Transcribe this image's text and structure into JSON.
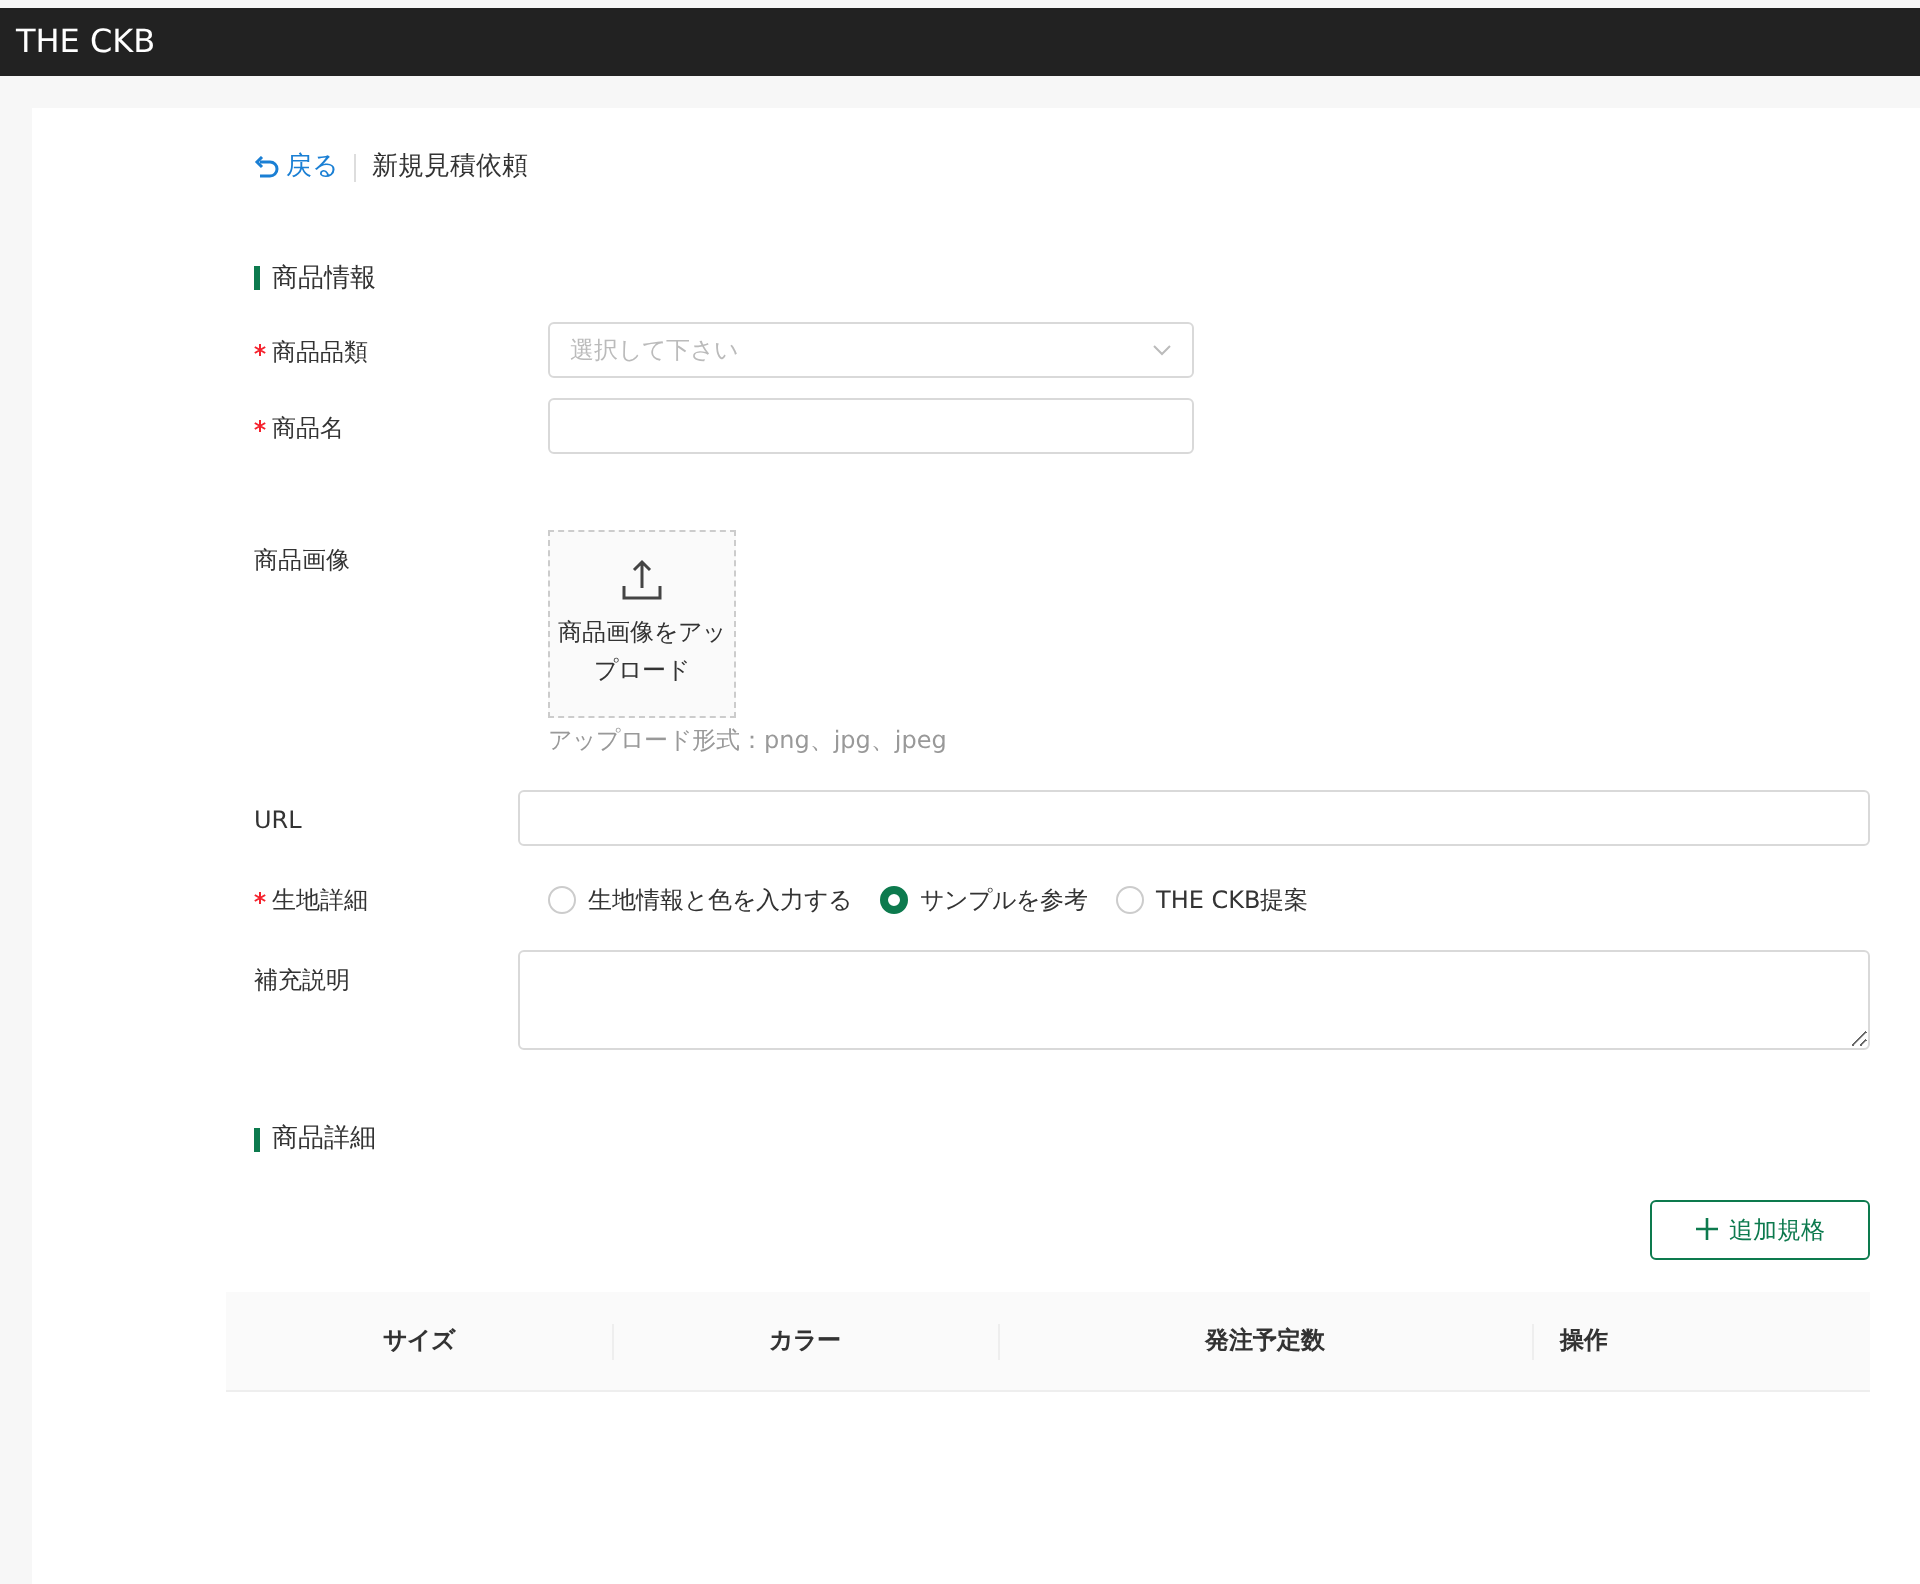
{
  "header": {
    "logo": "THE CKB"
  },
  "breadcrumb": {
    "back": "戻る",
    "title": "新規見積依頼"
  },
  "sections": [
    {
      "title": "商品情報",
      "fields": [
        {
          "kind": "select",
          "label": "商品品類",
          "required": true,
          "placeholder": "選択して下さい"
        },
        {
          "kind": "text",
          "label": "商品名",
          "required": true
        },
        {
          "kind": "upload",
          "label": "商品画像",
          "required": false,
          "button": "商品画像をアップロード",
          "hint": "アップロード形式：png、jpg、jpeg"
        },
        {
          "kind": "url",
          "label": "URL",
          "required": false
        },
        {
          "kind": "radio",
          "label": "生地詳細",
          "required": true,
          "options": [
            {
              "label": "生地情報と色を入力する",
              "selected": false
            },
            {
              "label": "サンプルを参考",
              "selected": true
            },
            {
              "label": "THE CKB提案",
              "selected": false
            }
          ]
        },
        {
          "kind": "textarea",
          "label": "補充説明",
          "required": false
        }
      ]
    },
    {
      "title": "商品詳細",
      "add_button": "追加規格",
      "table": {
        "columns": [
          "サイズ",
          "カラー",
          "発注予定数",
          "操作"
        ]
      }
    }
  ]
}
